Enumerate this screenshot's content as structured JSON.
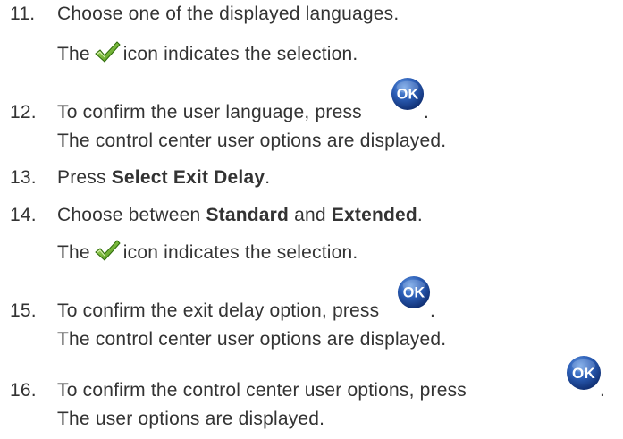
{
  "steps": [
    {
      "number": "11.",
      "text": "Choose one of the displayed languages.",
      "result_prefix": "The",
      "result_icon": "check-icon",
      "result_suffix": "icon indicates the selection."
    },
    {
      "number": "12.",
      "text": "To confirm the user language, press",
      "button_icon": "ok-icon",
      "button_label": "OK",
      "trailing": ".",
      "result": "The control center user options are displayed."
    },
    {
      "number": "13.",
      "text_before": "Press ",
      "bold": "Select Exit Delay",
      "text_after": "."
    },
    {
      "number": "14.",
      "text_before": "Choose between ",
      "bold1": "Standard",
      "text_middle": " and ",
      "bold2": "Extended",
      "text_after": ".",
      "result_prefix": "The",
      "result_icon": "check-icon",
      "result_suffix": "icon indicates the selection."
    },
    {
      "number": "15.",
      "text": "To confirm the exit delay option, press",
      "button_icon": "ok-icon",
      "button_label": "OK",
      "trailing": ".",
      "result": "The control center user options are displayed."
    },
    {
      "number": "16.",
      "text": "To confirm the control center user options, press",
      "button_icon": "ok-icon",
      "button_label": "OK",
      "trailing": ".",
      "result": "The user options are displayed."
    }
  ],
  "colors": {
    "text": "#333333",
    "ok_button_dark": "#0d2a6b",
    "ok_button_light": "#4a7fd0",
    "check_green": "#5aa61a"
  }
}
